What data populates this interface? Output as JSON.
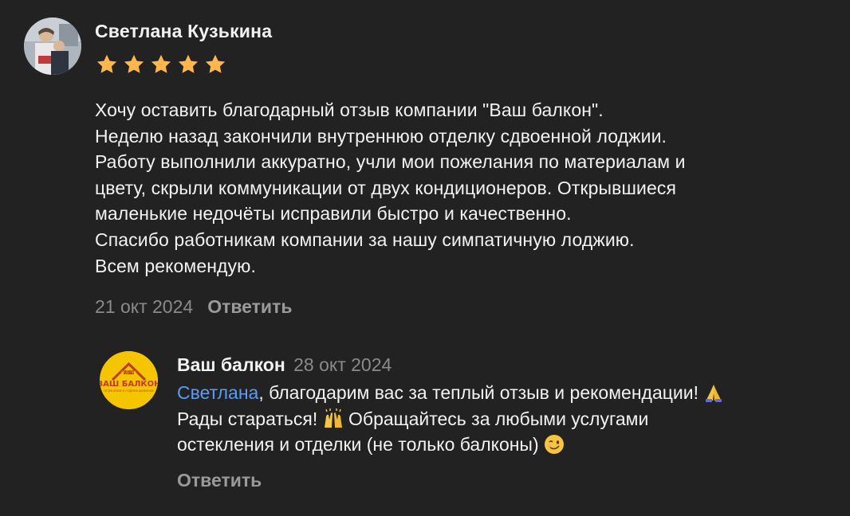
{
  "review": {
    "author_name": "Светлана Кузькина",
    "rating": 5,
    "star_color": "#ffb74d",
    "text_lines": [
      "Хочу оставить благодарный отзыв компании \"Ваш балкон\".",
      "Неделю назад закончили внутреннюю отделку сдвоенной лоджии.",
      "Работу выполнили аккуратно, учли мои пожелания по материалам и",
      "цвету, скрыли коммуникации от двух кондиционеров. Открывшиеся",
      "маленькие недочёты исправили быстро и качественно.",
      "Спасибо работникам компании за нашу симпатичную лоджию.",
      "Всем рекомендую."
    ],
    "date": "21 окт 2024",
    "reply_label": "Ответить"
  },
  "company_reply": {
    "company_name": "Ваш балкон",
    "date": "28 окт 2024",
    "logo_text_main": "ВАШ БАЛКОН",
    "logo_text_top": "ОТДЕЛКА",
    "logo_text_bottom": "ОСТЕКЛЕНИЕ И ОТДЕЛКА БАЛКОНОВ",
    "mention": "Светлана",
    "line1_rest": ", благодарим вас за теплый отзыв и рекомендации!",
    "line2_start": "Рады стараться!",
    "line2_rest": "Обращайтесь за любыми услугами",
    "line3": "остекления и отделки (не только балконы)",
    "emoji_1": "folded-hands-icon",
    "emoji_2": "raising-hands-icon",
    "emoji_3": "winking-face-icon",
    "reply_label": "Ответить",
    "mention_color": "#5a9cf2"
  }
}
